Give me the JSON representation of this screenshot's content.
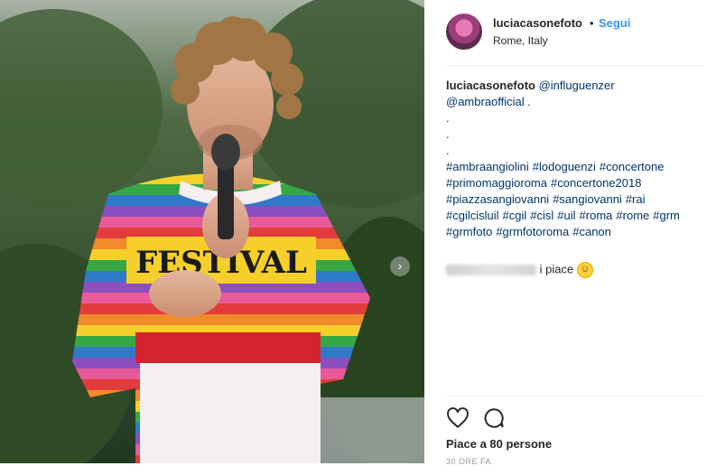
{
  "post": {
    "username": "luciacasonefoto",
    "separator": "•",
    "follow_label": "Segui",
    "location": "Rome, Italy"
  },
  "caption": {
    "username": "luciacasonefoto",
    "mentions": [
      "@influguenzer",
      "@ambraofficial"
    ],
    "mention_trailer": ".",
    "dots": [
      ".",
      ".",
      "."
    ],
    "hashtags": [
      "#ambraangiolini",
      "#lodoguenzi",
      "#concertone",
      "#primomaggioroma",
      "#concertone2018",
      "#piazzasangiovanni",
      "#sangiovanni",
      "#rai",
      "#cgilcisluil",
      "#cgil",
      "#cisl",
      "#uil",
      "#roma",
      "#rome",
      "#grm",
      "#grmfoto",
      "#grmfotoroma",
      "#canon"
    ]
  },
  "likes_line": {
    "suffix": "i piace"
  },
  "actions": {
    "like_count": "Piace a 80 persone",
    "date": "30 ORE FA"
  },
  "photo": {
    "sweater_text": "FESTIVAL",
    "next_arrow": "›"
  },
  "colors": {
    "link": "#003569",
    "follow": "#3897f0",
    "border": "#efefef"
  }
}
